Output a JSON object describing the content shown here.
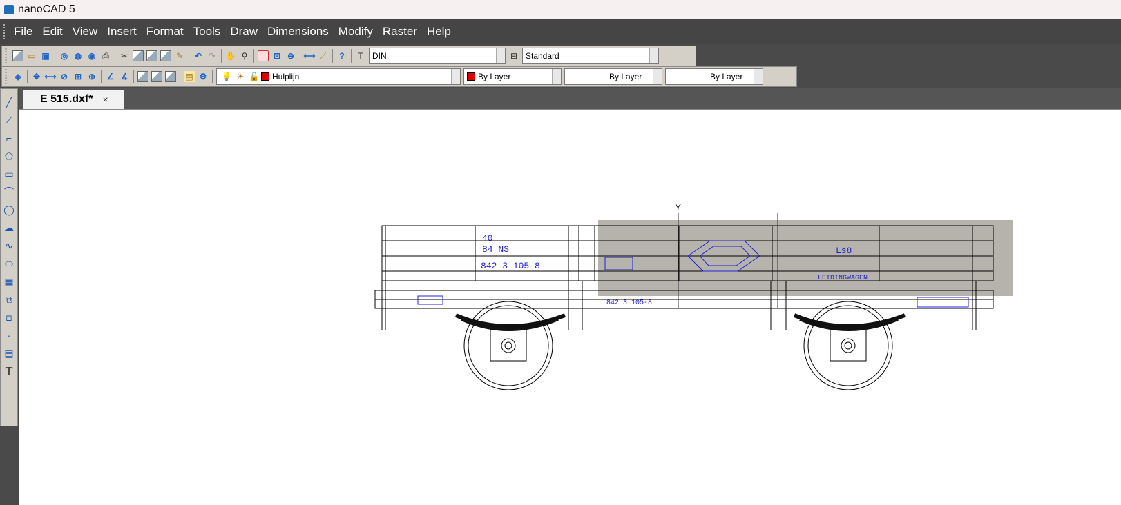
{
  "titlebar": {
    "title": "nanoCAD 5"
  },
  "menu": [
    "File",
    "Edit",
    "View",
    "Insert",
    "Format",
    "Tools",
    "Draw",
    "Dimensions",
    "Modify",
    "Raster",
    "Help"
  ],
  "toolbar": {
    "dim_style": "DIN",
    "text_style": "Standard",
    "layer": "Hulplijn",
    "color": "By Layer",
    "linetype": "By Layer",
    "lineweight": "By Layer"
  },
  "document": {
    "tab_label": "E 515.dxf*",
    "close_glyph": "×"
  },
  "drawing": {
    "ucs_label": "Y",
    "markings": {
      "m1": "40",
      "m2": "84 NS",
      "m3": "842 3 105-8",
      "m4": "Ls8",
      "m5": "LEIDINGWAGEN",
      "m6": "842 3 105-8"
    }
  },
  "colors": {
    "accent": "#1f6fb5",
    "marking_blue": "#2020dd",
    "menubar": "#454545"
  }
}
